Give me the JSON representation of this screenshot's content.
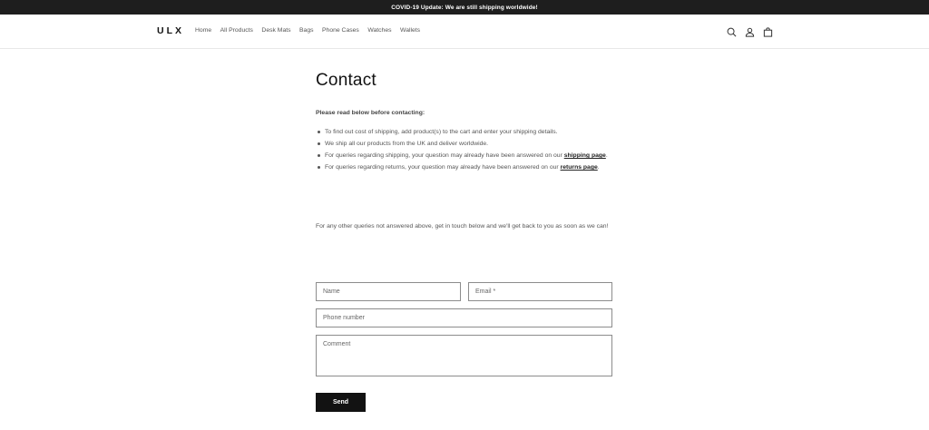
{
  "announcement": {
    "text": "COVID-19 Update: We are still shipping worldwide!"
  },
  "header": {
    "logo": "ULX",
    "nav": [
      {
        "label": "Home"
      },
      {
        "label": "All Products"
      },
      {
        "label": "Desk Mats"
      },
      {
        "label": "Bags"
      },
      {
        "label": "Phone Cases"
      },
      {
        "label": "Watches"
      },
      {
        "label": "Wallets"
      }
    ],
    "icons": [
      "search-icon",
      "account-icon",
      "cart-icon"
    ]
  },
  "main": {
    "title": "Contact",
    "intro_heading": "Please read below before contacting:",
    "bullets": {
      "b0": "To find out cost of shipping, add product(s) to the cart and enter your shipping details.",
      "b1": "We ship all our products from the UK and deliver worldwide.",
      "b2_pre": "For queries regarding shipping, your question may already have been answered on our ",
      "b2_link": "shipping page",
      "b2_post": ".",
      "b3_pre": "For queries regarding returns, your question may already have been answered on our ",
      "b3_link": "returns page",
      "b3_post": "."
    },
    "note": "For any other queries not answered above, get in touch below and we'll get back to you as soon as we can!"
  },
  "form": {
    "name_placeholder": "Name",
    "email_placeholder": "Email *",
    "phone_placeholder": "Phone number",
    "comment_placeholder": "Comment",
    "send_label": "Send"
  },
  "colors": {
    "announcement_bg": "#1e1e1e",
    "button_bg": "#121212",
    "field_border": "#8c8c8c"
  }
}
